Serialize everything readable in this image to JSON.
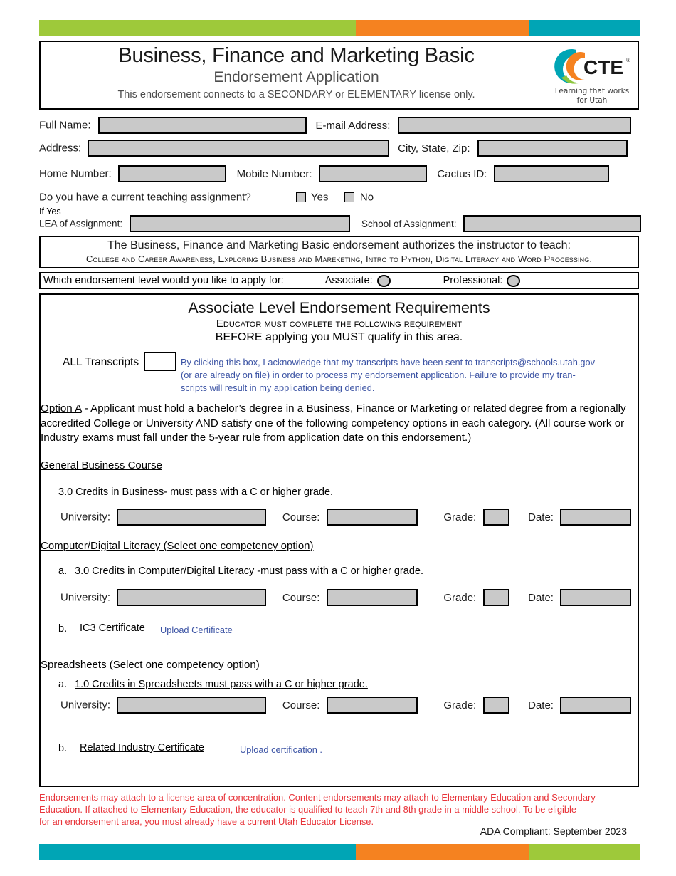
{
  "colors": {
    "green": "#9ec93a",
    "orange": "#f58220",
    "teal": "#00a5b5",
    "blue_text": "#3b53a4",
    "red_text": "#e8343a",
    "field_gray": "#c9c9c9"
  },
  "top_bar": {
    "segments": [
      "green",
      "orange",
      "teal"
    ]
  },
  "bottom_bar": {
    "segments": [
      "teal",
      "orange",
      "green"
    ]
  },
  "header": {
    "title": "Business, Finance and Marketing Basic",
    "subtitle": "Endorsement Application",
    "note": "This endorsement connects to a SECONDARY or ELEMENTARY license only.",
    "logo": {
      "wordmark": "CTE",
      "registered": "®",
      "tagline_line1": "Learning that works",
      "tagline_line2": "for Utah"
    }
  },
  "applicant": {
    "full_name_label": "Full Name:",
    "full_name_value": "",
    "email_label": "E-mail Address:",
    "email_value": "",
    "address_label": "Address:",
    "address_value": "",
    "city_state_zip_label": "City, State, Zip:",
    "city_state_zip_value": "",
    "home_number_label": "Home Number:",
    "home_number_value": "",
    "mobile_number_label": "Mobile Number:",
    "mobile_number_value": "",
    "cactus_id_label": "Cactus ID:",
    "cactus_id_value": "",
    "teaching_question": "Do you have a current teaching assignment?",
    "yes_label": "Yes",
    "no_label": "No",
    "if_yes_label": "If Yes",
    "lea_label": "LEA of Assignment:",
    "lea_value": "",
    "school_label": "School of Assignment:",
    "school_value": ""
  },
  "authorization": {
    "line1": "The Business, Finance and Marketing Basic endorsement authorizes the instructor to teach:",
    "line2": "College and Career Awareness, Exploring Business and Mareketing, Intro to Python, Digital Literacy and Word Processing."
  },
  "level_select": {
    "question": "Which endorsement level would you like to apply for:",
    "associate_label": "Associate:",
    "professional_label": "Professional:"
  },
  "requirements": {
    "title": "Associate Level Endorsement Requirements",
    "sub1": "Educator must complete the following requirement",
    "sub2": "BEFORE applying you MUST qualify in this area.",
    "transcripts_label": "ALL Transcripts",
    "transcripts_note_line1": "By clicking this box, I acknowledge that my transcripts have been sent to transcripts@schools.utah.gov",
    "transcripts_note_line2": "(or are already on file) in order to process my endorsement application. Failure to provide my tran-",
    "transcripts_note_line3": "scripts will result in my application being denied.",
    "option_a_tag": "Option A",
    "option_a_text": " - Applicant must hold a bachelor’s degree in a Business, Finance or Marketing or related degree from a regionally accredited College or University AND satisfy one of the following competency options in each category. (All course work or Industry exams must fall under the 5-year rule from application date on this endorsement.)"
  },
  "field_labels": {
    "university": "University:",
    "course": "Course:",
    "grade": "Grade:",
    "date": "Date:"
  },
  "sections": [
    {
      "heading": "General Business Course",
      "item_letter": "",
      "item_text": "3.0 Credits in Business- must pass with a C or higher grade.",
      "university_value": "",
      "course_value": "",
      "grade_value": "",
      "date_value": ""
    },
    {
      "heading": "Computer/Digital Literacy (Select one competency option)",
      "item_letter": "a.",
      "item_text": "3.0 Credits in Computer/Digital Literacy -must pass with a C or higher grade.",
      "university_value": "",
      "course_value": "",
      "grade_value": "",
      "date_value": "",
      "alt_letter": "b.",
      "alt_text": "IC3 Certificate",
      "alt_link": "Upload Certificate"
    },
    {
      "heading": "Spreadsheets (Select one competency option)",
      "item_letter": "a.",
      "item_text": "1.0 Credits in Spreadsheets must pass with a C or higher grade.",
      "university_value": "",
      "course_value": "",
      "grade_value": "",
      "date_value": "",
      "alt_letter": "b.",
      "alt_text": "Related Industry Certificate",
      "alt_link": "Upload certification ."
    }
  ],
  "footer": {
    "disclaimer_line1": "Endorsements may attach to a license area of concentration. Content endorsements may attach to Elementary Education and Secondary",
    "disclaimer_line2": "Education. If attached to Elementary Education,  the educator is qualified to teach 7th and 8th grade in a middle school. To be eligible",
    "disclaimer_line3": "for an endorsement area, you must already have a current Utah Educator License.",
    "ada": "ADA  Compliant: September 2023"
  }
}
